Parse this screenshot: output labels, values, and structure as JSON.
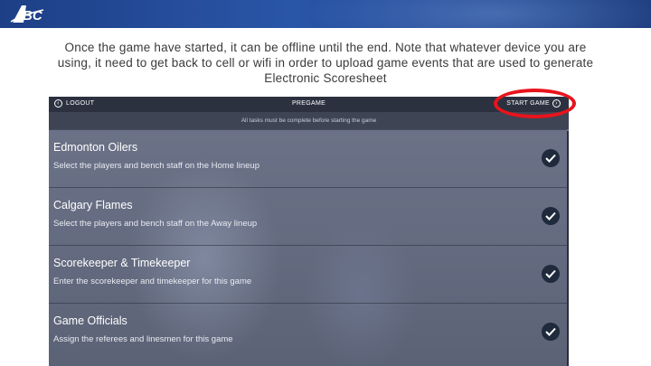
{
  "brand": {
    "logo_text": "ABC"
  },
  "caption": "Once the game have started, it can be offline until the end. Note that whatever device you are using, it need to get back to cell or wifi in order to upload game events that are used to generate Electronic Scoresheet",
  "app": {
    "header": {
      "logout_label": "LOGOUT",
      "title": "PREGAME",
      "start_label": "START GAME"
    },
    "subheader": "All tasks must be complete before starting the game",
    "tasks": [
      {
        "title": "Edmonton Oilers",
        "description": "Select the players and bench staff on the Home lineup"
      },
      {
        "title": "Calgary Flames",
        "description": "Select the players and bench staff on the Away lineup"
      },
      {
        "title": "Scorekeeper & Timekeeper",
        "description": "Enter the scorekeeper and timekeeper for this game"
      },
      {
        "title": "Game Officials",
        "description": "Assign the referees and linesmen for this game"
      }
    ]
  },
  "colors": {
    "header_blue": "#1d3f86",
    "highlight_red": "#e8141c",
    "app_bg": "#646b80"
  },
  "icons": [
    "logout-back-icon",
    "start-game-forward-icon",
    "check-icon"
  ]
}
